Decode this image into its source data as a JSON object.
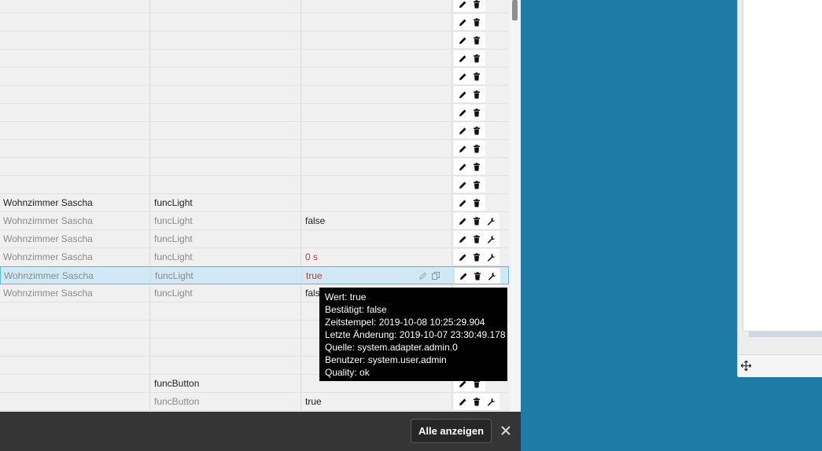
{
  "table": {
    "rows": [
      {
        "room": "",
        "func": "",
        "value": "",
        "value_class": "",
        "style": "normal",
        "wrench": false
      },
      {
        "room": "",
        "func": "",
        "value": "",
        "value_class": "",
        "style": "normal",
        "wrench": false
      },
      {
        "room": "",
        "func": "",
        "value": "",
        "value_class": "",
        "style": "normal",
        "wrench": false
      },
      {
        "room": "",
        "func": "",
        "value": "",
        "value_class": "",
        "style": "normal",
        "wrench": false
      },
      {
        "room": "",
        "func": "",
        "value": "",
        "value_class": "",
        "style": "normal",
        "wrench": false
      },
      {
        "room": "",
        "func": "",
        "value": "",
        "value_class": "",
        "style": "normal",
        "wrench": false
      },
      {
        "room": "",
        "func": "",
        "value": "",
        "value_class": "",
        "style": "normal",
        "wrench": false
      },
      {
        "room": "",
        "func": "",
        "value": "",
        "value_class": "",
        "style": "normal",
        "wrench": false
      },
      {
        "room": "",
        "func": "",
        "value": "",
        "value_class": "",
        "style": "normal",
        "wrench": false
      },
      {
        "room": "",
        "func": "",
        "value": "",
        "value_class": "",
        "style": "normal",
        "wrench": false
      },
      {
        "room": "",
        "func": "",
        "value": "",
        "value_class": "",
        "style": "normal",
        "wrench": false
      },
      {
        "room": "Wohnzimmer Sascha",
        "func": "funcLight",
        "value": "",
        "value_class": "",
        "style": "normal",
        "wrench": false
      },
      {
        "room": "Wohnzimmer Sascha",
        "func": "funcLight",
        "value": "false",
        "value_class": "val-black",
        "style": "gray",
        "wrench": true
      },
      {
        "room": "Wohnzimmer Sascha",
        "func": "funcLight",
        "value": "",
        "value_class": "",
        "style": "gray",
        "wrench": true
      },
      {
        "room": "Wohnzimmer Sascha",
        "func": "funcLight",
        "value": "0 s",
        "value_class": "val-red",
        "style": "gray",
        "wrench": true
      },
      {
        "room": "Wohnzimmer Sascha",
        "func": "funcLight",
        "value": "true",
        "value_class": "val-red",
        "style": "gray selected",
        "wrench": true
      },
      {
        "room": "Wohnzimmer Sascha",
        "func": "funcLight",
        "value": "false",
        "value_class": "val-black",
        "style": "gray",
        "wrench": true
      },
      {
        "room": "",
        "func": "",
        "value": "",
        "value_class": "",
        "style": "normal",
        "wrench": false
      },
      {
        "room": "",
        "func": "",
        "value": "",
        "value_class": "",
        "style": "normal",
        "wrench": false
      },
      {
        "room": "",
        "func": "",
        "value": "",
        "value_class": "",
        "style": "normal",
        "wrench": false
      },
      {
        "room": "",
        "func": "",
        "value": "",
        "value_class": "",
        "style": "normal",
        "wrench": false
      },
      {
        "room": "",
        "func": "funcButton",
        "value": "",
        "value_class": "",
        "style": "normal",
        "wrench": false
      },
      {
        "room": "",
        "func": "funcButton",
        "value": "true",
        "value_class": "val-black",
        "style": "gray",
        "wrench": true
      }
    ]
  },
  "tooltip": {
    "lines": [
      "Wert: true",
      "Bestätigt: false",
      "Zeitstempel: 2019-10-08 10:25:29.904",
      "Letzte Änderung: 2019-10-07 23:30:49.178",
      "Quelle: system.adapter.admin.0",
      "Benutzer: system.user.admin",
      "Quality: ok"
    ]
  },
  "bottom_bar": {
    "show_all_label": "Alle anzeigen"
  },
  "colors": {
    "desktop": "#1e7aa6",
    "selected_row": "#cfe9f7",
    "value_red": "#c0392b"
  },
  "icons": [
    "pencil-icon",
    "trash-icon",
    "wrench-icon",
    "copy-icon",
    "close-icon",
    "move-icon"
  ]
}
